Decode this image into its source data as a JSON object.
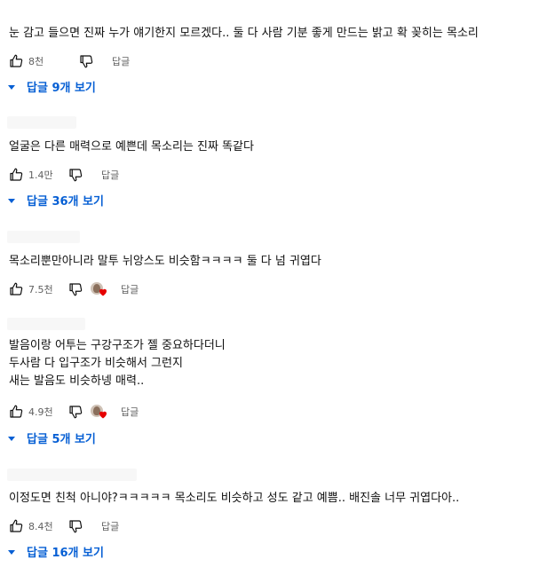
{
  "comments": [
    {
      "text": [
        "눈 감고 들으면 진짜 누가 얘기한지 모르겠다.. 둘 다 사람 기분 좋게 만드는 밝고 확 꽂히는 목소리"
      ],
      "likes": "8천",
      "reply": "답글",
      "replies": "답글 9개 보기",
      "hearted": false
    },
    {
      "text": [
        "얼굴은 다른 매력으로 예쁜데 목소리는 진짜 똑같다"
      ],
      "likes": "1.4만",
      "reply": "답글",
      "replies": "답글 36개 보기",
      "hearted": false
    },
    {
      "text": [
        "목소리뿐만아니라 말투 뉘앙스도 비슷함ㅋㅋㅋㅋ 둘 다 넘 귀엽다"
      ],
      "likes": "7.5천",
      "reply": "답글",
      "replies": null,
      "hearted": true
    },
    {
      "text": [
        "발음이랑 어투는 구강구조가 젤 중요하다더니",
        "두사람 다 입구조가 비슷해서 그런지",
        "새는 발음도 비슷하넹 매력.."
      ],
      "likes": "4.9천",
      "reply": "답글",
      "replies": "답글 5개 보기",
      "hearted": true
    },
    {
      "text": [
        "이정도면 친척 아니야?ㅋㅋㅋㅋㅋ 목소리도 비슷하고 성도 같고 예쁨.. 배진솔 너무 귀엽다아.."
      ],
      "likes": "8.4천",
      "reply": "답글",
      "replies": "답글 16개 보기",
      "hearted": false
    }
  ],
  "colors": {
    "link": "#065fd4",
    "heart": "#e60000",
    "meta": "#606060"
  },
  "icons": {
    "like": "thumb-up-icon",
    "dislike": "thumb-down-icon",
    "caret": "caret-down-icon",
    "heart": "heart-icon"
  }
}
